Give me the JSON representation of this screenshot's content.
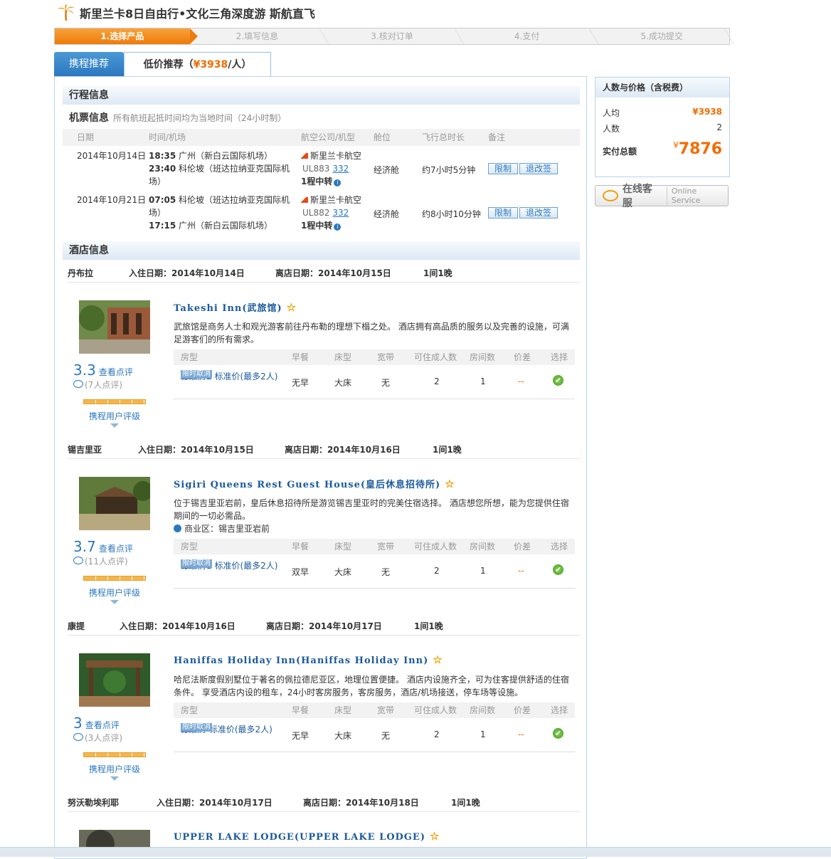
{
  "title": "斯里兰卡8日自由行•文化三角深度游 斯航直飞",
  "steps": [
    "1.选择产品",
    "2.填写信息",
    "3.核对订单",
    "4.支付",
    "5.成功提交"
  ],
  "tabs": {
    "recommend": "携程推荐",
    "lowprice_prefix": "低价推荐（",
    "lowprice_price": "¥3938",
    "lowprice_suffix": "/人）"
  },
  "itinerary": {
    "section_title": "行程信息",
    "flight_title": "机票信息",
    "flight_note": "所有航班起抵时间均为当地时间（24小时制）",
    "columns": [
      "日期",
      "时间/机场",
      "航空公司/机型",
      "舱位",
      "飞行总时长",
      "备注"
    ],
    "flights": [
      {
        "date": "2014年10月14日",
        "dep_time": "18:35",
        "dep_airport": "广州（新白云国际机场）",
        "arr_time": "23:40",
        "arr_airport": "科伦坡（班达拉纳亚克国际机场）",
        "airline": "斯里兰卡航空",
        "flight_no": "UL883",
        "plane": "332",
        "transfer": "1程中转",
        "cabin": "经济舱",
        "duration": "约7小时5分钟",
        "btn_limit": "限制",
        "btn_refund": "退改签"
      },
      {
        "date": "2014年10月21日",
        "dep_time": "07:05",
        "dep_airport": "科伦坡（班达拉纳亚克国际机场）",
        "arr_time": "17:15",
        "arr_airport": "广州（新白云国际机场）",
        "airline": "斯里兰卡航空",
        "flight_no": "UL882",
        "plane": "332",
        "transfer": "1程中转",
        "cabin": "经济舱",
        "duration": "约8小时10分钟",
        "btn_limit": "限制",
        "btn_refund": "退改签"
      }
    ]
  },
  "hotel_section_title": "酒店信息",
  "room_columns": [
    "房型",
    "早餐",
    "床型",
    "宽带",
    "可住成人数",
    "房间数",
    "价差",
    "选择"
  ],
  "hotels": [
    {
      "city": "丹布拉",
      "checkin": "入住日期：2014年10月14日",
      "checkout": "离店日期：2014年10月15日",
      "nights": "1间1晚",
      "name": "Takeshi Inn(武旅馆)",
      "desc": "武旅馆是商务人士和观光游客前往丹布勒的理想下榻之处。 酒店拥有高品质的服务以及完善的设施，可满足游客们的所有需求。",
      "biz": "",
      "score": "3.3",
      "score_link": "查看点评",
      "reviews": "(7人点评)",
      "rate_link": "携程用户评级",
      "room": {
        "name": "标准房2 标准价(最多2人)",
        "tag": "限时取消",
        "breakfast": "无早",
        "bed": "大床",
        "net": "无",
        "adults": "2",
        "rooms": "1",
        "diff": "--"
      }
    },
    {
      "city": "锡吉里亚",
      "checkin": "入住日期：2014年10月15日",
      "checkout": "离店日期：2014年10月16日",
      "nights": "1间1晚",
      "name": "Sigiri Queens Rest Guest House(皇后休息招待所)",
      "desc": "位于锡吉里亚岩前，皇后休息招待所是游览锡吉里亚时的完美住宿选择。 酒店想您所想，能为您提供住宿期间的一切必需品。",
      "biz": "商业区：锡吉里亚岩前",
      "score": "3.7",
      "score_link": "查看点评",
      "reviews": "(11人点评)",
      "rate_link": "携程用户评级",
      "room": {
        "name": "标准房1 标准价(最多2人)",
        "tag": "限时取消",
        "breakfast": "双早",
        "bed": "大床",
        "net": "无",
        "adults": "2",
        "rooms": "1",
        "diff": "--"
      }
    },
    {
      "city": "康提",
      "checkin": "入住日期：2014年10月16日",
      "checkout": "离店日期：2014年10月17日",
      "nights": "1间1晚",
      "name": "Haniffas Holiday Inn(Haniffas Holiday Inn)",
      "desc": "哈尼法斯度假别墅位于著名的佩拉德尼亚区，地理位置便捷。 酒店内设施齐全，可为住客提供舒适的住宿条件。 享受酒店内设的租车，24小时客房服务，客房服务，酒店/机场接送，停车场等设施。",
      "biz": "",
      "score": "3",
      "score_link": "查看点评",
      "reviews": "(3人点评)",
      "rate_link": "携程用户评级",
      "room": {
        "name": "标准房 标准价(最多2人)",
        "tag": "限时取消",
        "breakfast": "无早",
        "bed": "大床",
        "net": "无",
        "adults": "2",
        "rooms": "1",
        "diff": "--"
      }
    },
    {
      "city": "努沃勒埃利耶",
      "checkin": "入住日期：2014年10月17日",
      "checkout": "离店日期：2014年10月18日",
      "nights": "1间1晚",
      "name": "UPPER LAKE LODGE(UPPER LAKE LODGE)"
    }
  ],
  "side": {
    "title": "人数与价格（含税费）",
    "per_label": "人均",
    "per_value": "¥3938",
    "count_label": "人数",
    "count_value": "2",
    "total_label": "实付总额",
    "total_yen": "¥",
    "total_value": "7876"
  },
  "service": {
    "cn": "在线客服",
    "en": "Online Service"
  },
  "colors": {
    "accent_orange": "#f26c00",
    "link_blue": "#1a5a9c",
    "tab_blue": "#2b78c0"
  }
}
